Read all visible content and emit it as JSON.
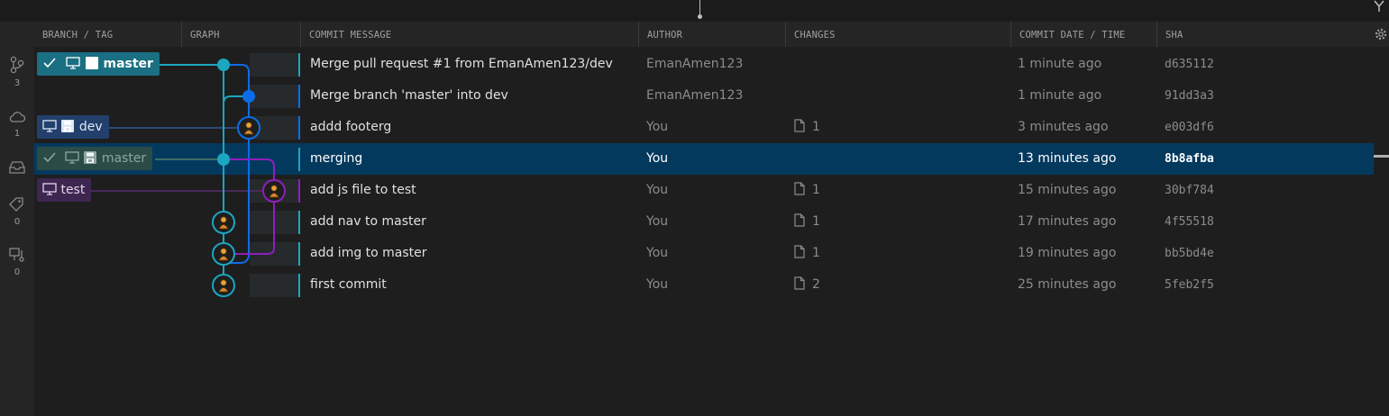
{
  "columns": {
    "branch_tag": "BRANCH / TAG",
    "graph": "GRAPH",
    "commit_message": "COMMIT MESSAGE",
    "author": "AUTHOR",
    "changes": "CHANGES",
    "commit_date": "COMMIT DATE / TIME",
    "sha": "SHA"
  },
  "activity": {
    "branches_count": "3",
    "remotes_count": "1",
    "stashes_count": "",
    "tags_count": "0",
    "worktrees_count": "0"
  },
  "refs": {
    "master_local": "master",
    "dev": "dev",
    "master_ghost": "master",
    "test": "test"
  },
  "colors": {
    "lane_teal": "#1ba6c1",
    "lane_blue": "#0d6de8",
    "lane_purple": "#8e1fbd",
    "selection": "#04395e"
  },
  "commits": [
    {
      "message": "Merge pull request #1 from EmanAmen123/dev",
      "author": "EmanAmen123",
      "changes": "",
      "date": "1 minute ago",
      "sha": "d635112",
      "lane_color": "#1ba6c1"
    },
    {
      "message": "Merge branch 'master' into dev",
      "author": "EmanAmen123",
      "changes": "",
      "date": "1 minute ago",
      "sha": "91dd3a3",
      "lane_color": "#0d6de8"
    },
    {
      "message": "addd footerg",
      "author": "You",
      "changes": "1",
      "date": "3 minutes ago",
      "sha": "e003df6",
      "lane_color": "#0d6de8"
    },
    {
      "message": "merging",
      "author": "You",
      "changes": "",
      "date": "13 minutes ago",
      "sha": "8b8afba",
      "lane_color": "#1ba6c1",
      "selected": true
    },
    {
      "message": "add js file to test",
      "author": "You",
      "changes": "1",
      "date": "15 minutes ago",
      "sha": "30bf784",
      "lane_color": "#8e1fbd"
    },
    {
      "message": "add nav to master",
      "author": "You",
      "changes": "1",
      "date": "17 minutes ago",
      "sha": "4f55518",
      "lane_color": "#1ba6c1"
    },
    {
      "message": "add img to master",
      "author": "You",
      "changes": "1",
      "date": "19 minutes ago",
      "sha": "bb5bd4e",
      "lane_color": "#1ba6c1"
    },
    {
      "message": "first commit",
      "author": "You",
      "changes": "2",
      "date": "25 minutes ago",
      "sha": "5feb2f5",
      "lane_color": "#1ba6c1"
    }
  ]
}
